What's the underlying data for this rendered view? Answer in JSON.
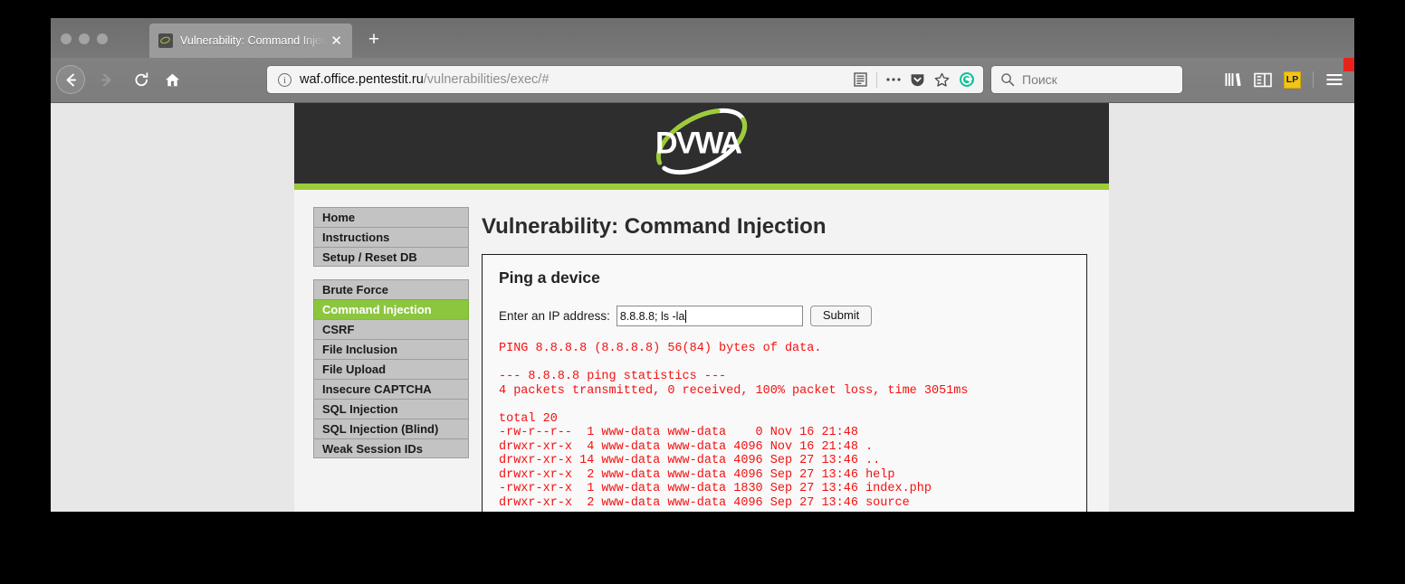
{
  "browser": {
    "tab": {
      "title": "Vulnerability: Command Injection",
      "close_label": "✕",
      "favicon_name": "dvwa-favicon"
    },
    "new_tab_label": "+",
    "nav": {
      "back_label": "←",
      "forward_label": "→",
      "reload_label": "↻",
      "home_label": "⌂"
    },
    "url": {
      "domain": "waf.office.pentestit.ru",
      "path": "/vulnerabilities/exec/#",
      "info_label": "i"
    },
    "url_actions": [
      "reader-view-icon",
      "page-actions-icon",
      "pocket-icon",
      "bookmark-star-icon",
      "grammarly-icon"
    ],
    "search": {
      "placeholder": "Поиск"
    },
    "toolbar_right": {
      "library_label": "library-icon",
      "sidebar_label": "sidebar-icon",
      "lastpass_label": "LP",
      "menu_label": "☰"
    }
  },
  "page": {
    "logo_text": "DVWA",
    "accent_green": "#9ccc37",
    "header_dark": "#2e2e2e",
    "title": "Vulnerability: Command Injection",
    "sidebar": {
      "group1": [
        {
          "label": "Home",
          "selected": false
        },
        {
          "label": "Instructions",
          "selected": false
        },
        {
          "label": "Setup / Reset DB",
          "selected": false
        }
      ],
      "group2": [
        {
          "label": "Brute Force",
          "selected": false
        },
        {
          "label": "Command Injection",
          "selected": true
        },
        {
          "label": "CSRF",
          "selected": false
        },
        {
          "label": "File Inclusion",
          "selected": false
        },
        {
          "label": "File Upload",
          "selected": false
        },
        {
          "label": "Insecure CAPTCHA",
          "selected": false
        },
        {
          "label": "SQL Injection",
          "selected": false
        },
        {
          "label": "SQL Injection (Blind)",
          "selected": false
        },
        {
          "label": "Weak Session IDs",
          "selected": false
        }
      ]
    },
    "form": {
      "box_title": "Ping a device",
      "ip_label": "Enter an IP address:",
      "ip_value": "8.8.8.8; ls -la",
      "ip_placeholder": "",
      "submit_label": "Submit"
    },
    "output": {
      "text_color": "#f41111",
      "block1": "PING 8.8.8.8 (8.8.8.8) 56(84) bytes of data.",
      "block2_line1": "--- 8.8.8.8 ping statistics ---",
      "block2_line2": "4 packets transmitted, 0 received, 100% packet loss, time 3051ms",
      "block3": "total 20\n-rw-r--r--  1 www-data www-data    0 Nov 16 21:48\ndrwxr-xr-x  4 www-data www-data 4096 Nov 16 21:48 .\ndrwxr-xr-x 14 www-data www-data 4096 Sep 27 13:46 ..\ndrwxr-xr-x  2 www-data www-data 4096 Sep 27 13:46 help\n-rwxr-xr-x  1 www-data www-data 1830 Sep 27 13:46 index.php\ndrwxr-xr-x  2 www-data www-data 4096 Sep 27 13:46 source"
    }
  }
}
